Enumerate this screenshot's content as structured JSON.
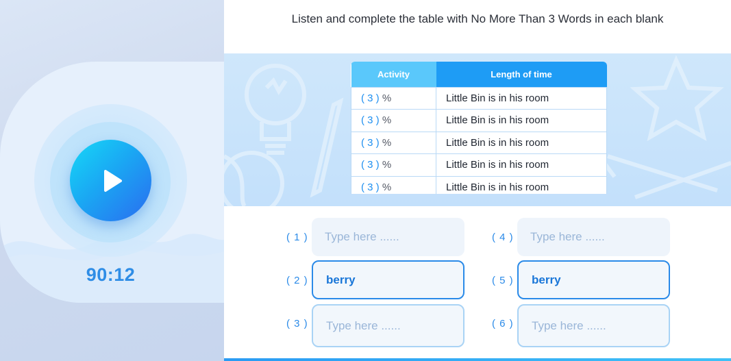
{
  "player": {
    "timer": "90:12",
    "icon": "play-icon"
  },
  "question": {
    "text": "Listen and complete the table with No More Than 3 Words in each blank"
  },
  "table": {
    "headers": [
      "Activity",
      "Length of time"
    ],
    "rows": [
      {
        "num": "( 3 )",
        "unit": "%",
        "text": "Little Bin is in his room"
      },
      {
        "num": "( 3 )",
        "unit": "%",
        "text": "Little Bin is in his room"
      },
      {
        "num": "( 3 )",
        "unit": "%",
        "text": "Little Bin is in his room"
      },
      {
        "num": "( 3 )",
        "unit": "%",
        "text": "Little Bin is in his room"
      },
      {
        "num": "( 3 )",
        "unit": "%",
        "text": "Little Bin is in his room"
      }
    ]
  },
  "answers": [
    {
      "label": "( 1 )",
      "value": "",
      "placeholder": "Type here ......"
    },
    {
      "label": "( 2 )",
      "value": "berry",
      "placeholder": ""
    },
    {
      "label": "( 3 )",
      "value": "",
      "placeholder": "Type here ......"
    },
    {
      "label": "( 4 )",
      "value": "",
      "placeholder": "Type here ......"
    },
    {
      "label": "( 5 )",
      "value": "berry",
      "placeholder": ""
    },
    {
      "label": "( 6 )",
      "value": "",
      "placeholder": "Type here ......"
    }
  ],
  "colors": {
    "accent": "#2a8ae8",
    "header_light": "#5ac8fb",
    "header_dark": "#1e9cf5"
  }
}
